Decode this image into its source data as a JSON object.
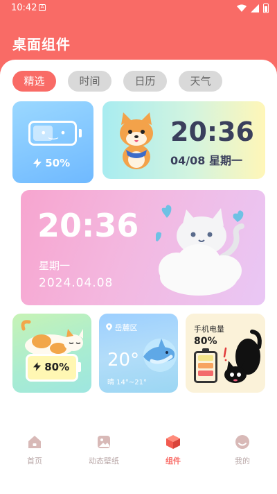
{
  "status_bar": {
    "time": "10:42",
    "notification_glyph": "A"
  },
  "header": {
    "title": "桌面组件"
  },
  "tabs": [
    {
      "label": "精选",
      "active": true
    },
    {
      "label": "时间",
      "active": false
    },
    {
      "label": "日历",
      "active": false
    },
    {
      "label": "天气",
      "active": false
    }
  ],
  "widgets": {
    "battery": {
      "face": "•‿•",
      "percent_text": "50%",
      "level": 0.5
    },
    "shiba_clock": {
      "time": "20:36",
      "date": "04/08 星期一"
    },
    "cat_clock": {
      "time": "20:36",
      "weekday": "星期一",
      "date": "2024.04.08"
    },
    "cat_battery": {
      "percent_text": "80%",
      "level": 0.8
    },
    "weather": {
      "location": "岳麓区",
      "temperature": "20°",
      "condition": "晴 14°~21°"
    },
    "phone_battery": {
      "label": "手机电量",
      "percent_text": "80%",
      "level": 0.8
    }
  },
  "bottom_nav": [
    {
      "label": "首页",
      "icon": "home-icon",
      "active": false
    },
    {
      "label": "动态壁纸",
      "icon": "wallpaper-icon",
      "active": false
    },
    {
      "label": "组件",
      "icon": "cube-icon",
      "active": true
    },
    {
      "label": "我的",
      "icon": "profile-icon",
      "active": false
    }
  ],
  "colors": {
    "accent": "#f96b66",
    "tab_inactive": "#d9d9d9",
    "nav_inactive": "#b9a7a7"
  }
}
